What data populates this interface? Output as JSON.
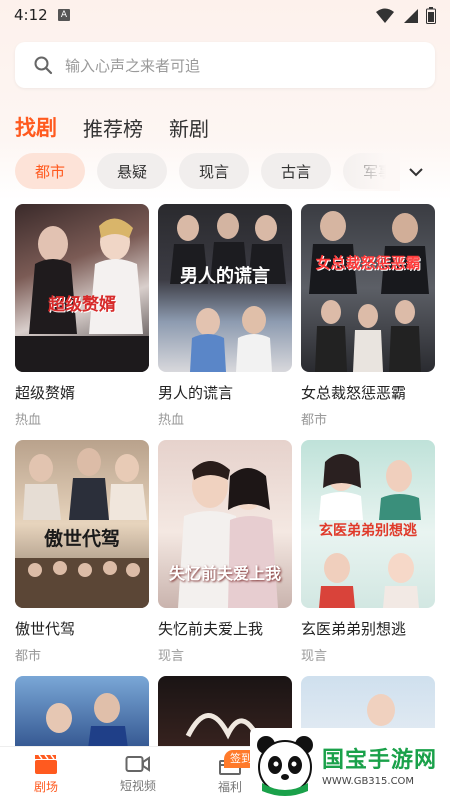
{
  "status_bar": {
    "time": "4:12",
    "notif": "A"
  },
  "search": {
    "placeholder": "输入心声之来者可追"
  },
  "main_tabs": [
    {
      "label": "找剧",
      "active": true
    },
    {
      "label": "推荐榜",
      "active": false
    },
    {
      "label": "新剧",
      "active": false
    }
  ],
  "categories": [
    {
      "label": "都市",
      "active": true
    },
    {
      "label": "悬疑",
      "active": false
    },
    {
      "label": "现言",
      "active": false
    },
    {
      "label": "古言",
      "active": false
    },
    {
      "label": "军事",
      "active": false
    }
  ],
  "dramas": [
    {
      "title": "超级赘婿",
      "tag": "热血",
      "poster_text": "超级赘婿"
    },
    {
      "title": "男人的谎言",
      "tag": "热血",
      "poster_text": "男人的谎言"
    },
    {
      "title": "女总裁怒惩恶霸",
      "tag": "都市",
      "poster_text": "女总裁怒惩恶霸"
    },
    {
      "title": "傲世代驾",
      "tag": "都市",
      "poster_text": "傲世代驾"
    },
    {
      "title": "失忆前夫爱上我",
      "tag": "现言",
      "poster_text": "失忆前夫爱上我"
    },
    {
      "title": "玄医弟弟别想逃",
      "tag": "现言",
      "poster_text": "玄医弟弟别想逃"
    }
  ],
  "bottom_nav": [
    {
      "label": "剧场",
      "icon": "clapperboard-icon",
      "active": true
    },
    {
      "label": "短视频",
      "icon": "video-camera-icon",
      "active": false
    },
    {
      "label": "福利",
      "icon": "gift-icon",
      "active": false
    }
  ],
  "sign_badge": "签到",
  "watermark": {
    "main": "国宝手游网",
    "sub": "WWW.GB315.COM"
  },
  "colors": {
    "accent": "#ff5a1f",
    "chip_bg": "#f1eeed",
    "chip_active_bg": "#fde3d8"
  }
}
